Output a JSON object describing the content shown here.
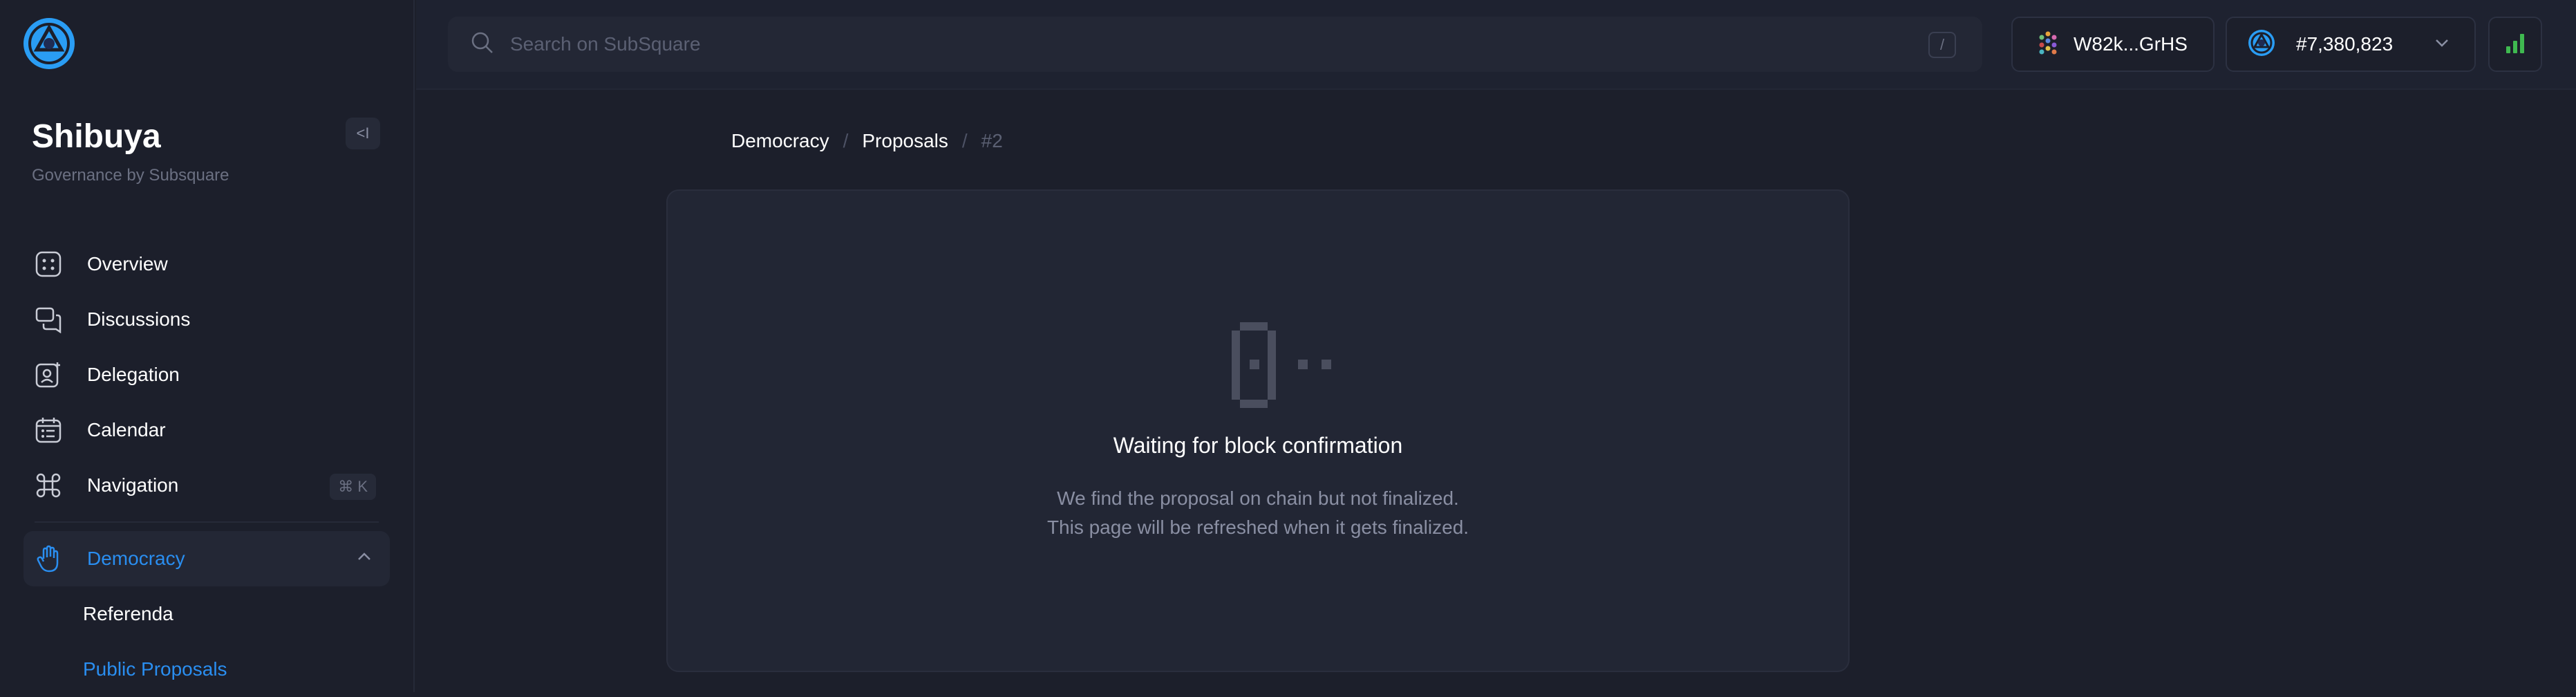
{
  "sidebar": {
    "title": "Shibuya",
    "subtitle": "Governance by Subsquare",
    "collapse_label": "<I",
    "items": [
      {
        "label": "Overview",
        "icon": "overview-icon"
      },
      {
        "label": "Discussions",
        "icon": "discussions-icon"
      },
      {
        "label": "Delegation",
        "icon": "delegation-icon"
      },
      {
        "label": "Calendar",
        "icon": "calendar-icon"
      },
      {
        "label": "Navigation",
        "icon": "command-icon",
        "shortcut": "⌘ K"
      }
    ],
    "democracy": {
      "label": "Democracy",
      "icon": "hand-icon",
      "sub_items": [
        {
          "label": "Referenda"
        },
        {
          "label": "Public Proposals"
        }
      ]
    }
  },
  "search": {
    "placeholder": "Search on SubSquare",
    "shortcut": "/"
  },
  "account": {
    "address": "W82k...GrHS"
  },
  "block": {
    "number": "#7,380,823"
  },
  "breadcrumb": {
    "items": [
      "Democracy",
      "Proposals"
    ],
    "current": "#2"
  },
  "status": {
    "title": "Waiting for block confirmation",
    "line1": "We find the proposal on chain but not finalized.",
    "line2": "This page will be refreshed when it gets finalized."
  },
  "colors": {
    "accent": "#2a8ef0",
    "background": "#1c1f2b",
    "card": "#222634",
    "signal": "#3fb950"
  }
}
